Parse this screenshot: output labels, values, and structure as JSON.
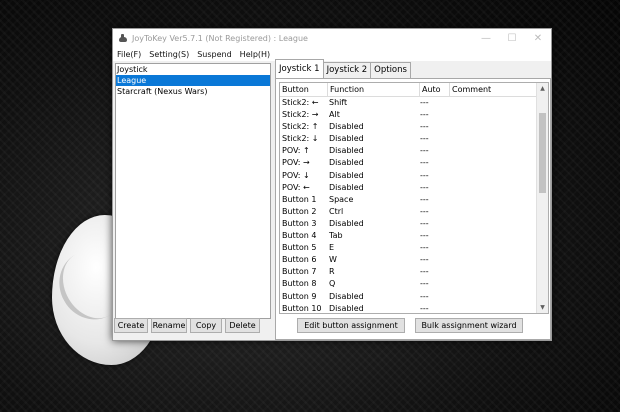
{
  "window": {
    "title": "JoyToKey Ver5.7.1 (Not Registered) : League",
    "minimize": "—",
    "maximize": "☐",
    "close": "✕"
  },
  "menu": [
    "File(F)",
    "Setting(S)",
    "Suspend",
    "Help(H)"
  ],
  "profiles": {
    "items": [
      "Joystick",
      "League",
      "Starcraft (Nexus Wars)"
    ],
    "selected": 1
  },
  "profile_buttons": {
    "create": "Create",
    "rename": "Rename",
    "copy": "Copy",
    "delete": "Delete"
  },
  "tabs": [
    "Joystick 1",
    "Joystick 2",
    "Options"
  ],
  "active_tab": 0,
  "table": {
    "headers": [
      "Button",
      "Function",
      "Auto",
      "Comment"
    ],
    "rows": [
      {
        "button": "Stick2: ←",
        "function": "Shift",
        "auto": "---",
        "comment": ""
      },
      {
        "button": "Stick2: →",
        "function": "Alt",
        "auto": "---",
        "comment": ""
      },
      {
        "button": "Stick2: ↑",
        "function": "Disabled",
        "auto": "---",
        "comment": ""
      },
      {
        "button": "Stick2: ↓",
        "function": "Disabled",
        "auto": "---",
        "comment": ""
      },
      {
        "button": "POV: ↑",
        "function": "Disabled",
        "auto": "---",
        "comment": ""
      },
      {
        "button": "POV: →",
        "function": "Disabled",
        "auto": "---",
        "comment": ""
      },
      {
        "button": "POV: ↓",
        "function": "Disabled",
        "auto": "---",
        "comment": ""
      },
      {
        "button": "POV: ←",
        "function": "Disabled",
        "auto": "---",
        "comment": ""
      },
      {
        "button": "Button 1",
        "function": "Space",
        "auto": "---",
        "comment": ""
      },
      {
        "button": "Button 2",
        "function": "Ctrl",
        "auto": "---",
        "comment": ""
      },
      {
        "button": "Button 3",
        "function": "Disabled",
        "auto": "---",
        "comment": ""
      },
      {
        "button": "Button 4",
        "function": "Tab",
        "auto": "---",
        "comment": ""
      },
      {
        "button": "Button 5",
        "function": "E",
        "auto": "---",
        "comment": ""
      },
      {
        "button": "Button 6",
        "function": "W",
        "auto": "---",
        "comment": ""
      },
      {
        "button": "Button 7",
        "function": "R",
        "auto": "---",
        "comment": ""
      },
      {
        "button": "Button 8",
        "function": "Q",
        "auto": "---",
        "comment": ""
      },
      {
        "button": "Button 9",
        "function": "Disabled",
        "auto": "---",
        "comment": ""
      },
      {
        "button": "Button 10",
        "function": "Disabled",
        "auto": "---",
        "comment": ""
      }
    ]
  },
  "scroll": {
    "up": "▲",
    "down": "▼"
  },
  "assignment_buttons": {
    "edit": "Edit button assignment",
    "bulk": "Bulk assignment wizard"
  },
  "colors": {
    "selection": "#0a78d7"
  }
}
